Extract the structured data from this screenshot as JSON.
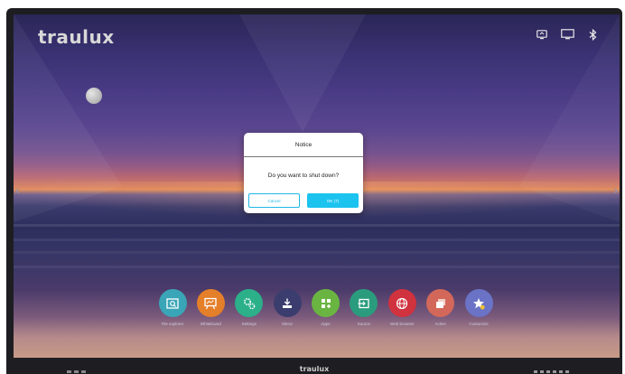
{
  "brand": {
    "logo_text": "traulux",
    "footer_text": "traulux"
  },
  "status_bar": {
    "icons": [
      "screen-share-icon",
      "display-icon",
      "bluetooth-icon"
    ]
  },
  "dialog": {
    "title": "Notice",
    "message": "Do you want to shut down?",
    "cancel_label": "Cancel",
    "ok_label": "OK (7)",
    "accent_color": "#1cc3ef"
  },
  "dock": {
    "apps": [
      {
        "label": "File explorer",
        "icon": "folder-search-icon",
        "color": "#3aa5b7"
      },
      {
        "label": "Whiteboard",
        "icon": "whiteboard-icon",
        "color": "#e47f2a"
      },
      {
        "label": "Settings",
        "icon": "gear-icon",
        "color": "#2bb08a"
      },
      {
        "label": "Mirror",
        "icon": "download-tray-icon",
        "color": "#3b3d6e"
      },
      {
        "label": "Apps",
        "icon": "apps-grid-icon",
        "color": "#6ab542"
      },
      {
        "label": "Source",
        "icon": "input-source-icon",
        "color": "#2a9c7d"
      },
      {
        "label": "Web browser",
        "icon": "globe-icon",
        "color": "#d0323e"
      },
      {
        "label": "Active",
        "icon": "windows-icon",
        "color": "#d3685a"
      },
      {
        "label": "Customize",
        "icon": "star-plus-icon",
        "color": "#6a73c6"
      }
    ]
  }
}
